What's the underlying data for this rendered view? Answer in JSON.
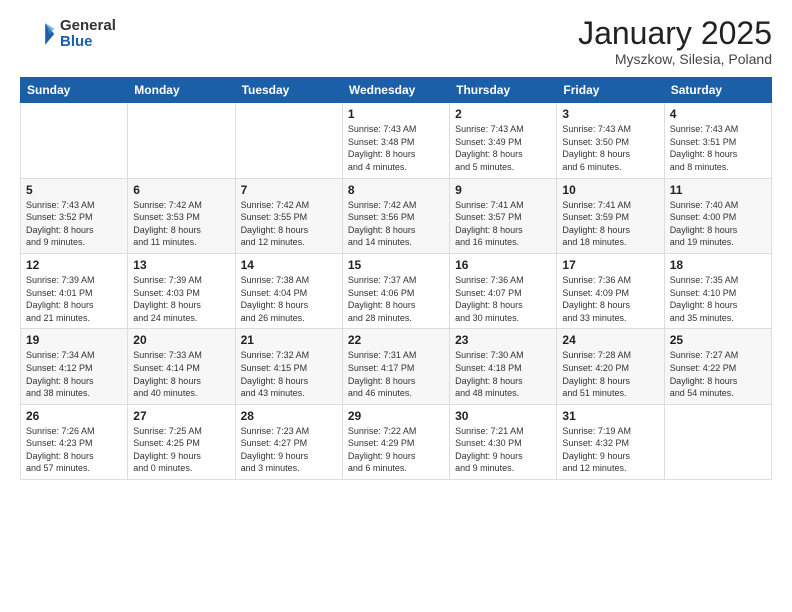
{
  "header": {
    "logo_general": "General",
    "logo_blue": "Blue",
    "month_title": "January 2025",
    "subtitle": "Myszkow, Silesia, Poland"
  },
  "weekdays": [
    "Sunday",
    "Monday",
    "Tuesday",
    "Wednesday",
    "Thursday",
    "Friday",
    "Saturday"
  ],
  "weeks": [
    [
      {
        "day": "",
        "info": ""
      },
      {
        "day": "",
        "info": ""
      },
      {
        "day": "",
        "info": ""
      },
      {
        "day": "1",
        "info": "Sunrise: 7:43 AM\nSunset: 3:48 PM\nDaylight: 8 hours\nand 4 minutes."
      },
      {
        "day": "2",
        "info": "Sunrise: 7:43 AM\nSunset: 3:49 PM\nDaylight: 8 hours\nand 5 minutes."
      },
      {
        "day": "3",
        "info": "Sunrise: 7:43 AM\nSunset: 3:50 PM\nDaylight: 8 hours\nand 6 minutes."
      },
      {
        "day": "4",
        "info": "Sunrise: 7:43 AM\nSunset: 3:51 PM\nDaylight: 8 hours\nand 8 minutes."
      }
    ],
    [
      {
        "day": "5",
        "info": "Sunrise: 7:43 AM\nSunset: 3:52 PM\nDaylight: 8 hours\nand 9 minutes."
      },
      {
        "day": "6",
        "info": "Sunrise: 7:42 AM\nSunset: 3:53 PM\nDaylight: 8 hours\nand 11 minutes."
      },
      {
        "day": "7",
        "info": "Sunrise: 7:42 AM\nSunset: 3:55 PM\nDaylight: 8 hours\nand 12 minutes."
      },
      {
        "day": "8",
        "info": "Sunrise: 7:42 AM\nSunset: 3:56 PM\nDaylight: 8 hours\nand 14 minutes."
      },
      {
        "day": "9",
        "info": "Sunrise: 7:41 AM\nSunset: 3:57 PM\nDaylight: 8 hours\nand 16 minutes."
      },
      {
        "day": "10",
        "info": "Sunrise: 7:41 AM\nSunset: 3:59 PM\nDaylight: 8 hours\nand 18 minutes."
      },
      {
        "day": "11",
        "info": "Sunrise: 7:40 AM\nSunset: 4:00 PM\nDaylight: 8 hours\nand 19 minutes."
      }
    ],
    [
      {
        "day": "12",
        "info": "Sunrise: 7:39 AM\nSunset: 4:01 PM\nDaylight: 8 hours\nand 21 minutes."
      },
      {
        "day": "13",
        "info": "Sunrise: 7:39 AM\nSunset: 4:03 PM\nDaylight: 8 hours\nand 24 minutes."
      },
      {
        "day": "14",
        "info": "Sunrise: 7:38 AM\nSunset: 4:04 PM\nDaylight: 8 hours\nand 26 minutes."
      },
      {
        "day": "15",
        "info": "Sunrise: 7:37 AM\nSunset: 4:06 PM\nDaylight: 8 hours\nand 28 minutes."
      },
      {
        "day": "16",
        "info": "Sunrise: 7:36 AM\nSunset: 4:07 PM\nDaylight: 8 hours\nand 30 minutes."
      },
      {
        "day": "17",
        "info": "Sunrise: 7:36 AM\nSunset: 4:09 PM\nDaylight: 8 hours\nand 33 minutes."
      },
      {
        "day": "18",
        "info": "Sunrise: 7:35 AM\nSunset: 4:10 PM\nDaylight: 8 hours\nand 35 minutes."
      }
    ],
    [
      {
        "day": "19",
        "info": "Sunrise: 7:34 AM\nSunset: 4:12 PM\nDaylight: 8 hours\nand 38 minutes."
      },
      {
        "day": "20",
        "info": "Sunrise: 7:33 AM\nSunset: 4:14 PM\nDaylight: 8 hours\nand 40 minutes."
      },
      {
        "day": "21",
        "info": "Sunrise: 7:32 AM\nSunset: 4:15 PM\nDaylight: 8 hours\nand 43 minutes."
      },
      {
        "day": "22",
        "info": "Sunrise: 7:31 AM\nSunset: 4:17 PM\nDaylight: 8 hours\nand 46 minutes."
      },
      {
        "day": "23",
        "info": "Sunrise: 7:30 AM\nSunset: 4:18 PM\nDaylight: 8 hours\nand 48 minutes."
      },
      {
        "day": "24",
        "info": "Sunrise: 7:28 AM\nSunset: 4:20 PM\nDaylight: 8 hours\nand 51 minutes."
      },
      {
        "day": "25",
        "info": "Sunrise: 7:27 AM\nSunset: 4:22 PM\nDaylight: 8 hours\nand 54 minutes."
      }
    ],
    [
      {
        "day": "26",
        "info": "Sunrise: 7:26 AM\nSunset: 4:23 PM\nDaylight: 8 hours\nand 57 minutes."
      },
      {
        "day": "27",
        "info": "Sunrise: 7:25 AM\nSunset: 4:25 PM\nDaylight: 9 hours\nand 0 minutes."
      },
      {
        "day": "28",
        "info": "Sunrise: 7:23 AM\nSunset: 4:27 PM\nDaylight: 9 hours\nand 3 minutes."
      },
      {
        "day": "29",
        "info": "Sunrise: 7:22 AM\nSunset: 4:29 PM\nDaylight: 9 hours\nand 6 minutes."
      },
      {
        "day": "30",
        "info": "Sunrise: 7:21 AM\nSunset: 4:30 PM\nDaylight: 9 hours\nand 9 minutes."
      },
      {
        "day": "31",
        "info": "Sunrise: 7:19 AM\nSunset: 4:32 PM\nDaylight: 9 hours\nand 12 minutes."
      },
      {
        "day": "",
        "info": ""
      }
    ]
  ]
}
